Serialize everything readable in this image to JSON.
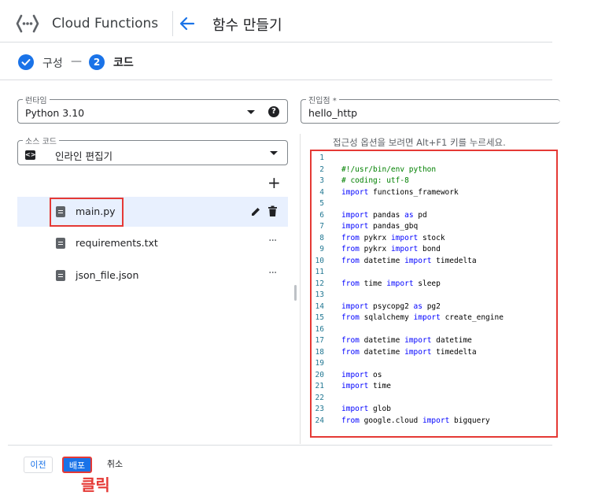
{
  "header": {
    "app_title": "Cloud Functions",
    "page_title": "함수 만들기",
    "icons": [
      "cloud-functions-logo",
      "back-arrow-icon"
    ]
  },
  "stepper": {
    "step1_label": "구성",
    "separator": "—",
    "step2_number": "2",
    "step2_label": "코드"
  },
  "runtime": {
    "label": "런타임",
    "value": "Python 3.10"
  },
  "entry_point": {
    "label": "진입점 *",
    "value": "hello_http"
  },
  "source_code": {
    "label": "소스 코드",
    "value": "인라인 편집기",
    "icon_glyph": "<>"
  },
  "files": {
    "add_glyph": "+",
    "items": [
      {
        "name": "main.py"
      },
      {
        "name": "requirements.txt"
      },
      {
        "name": "json_file.json"
      }
    ],
    "more_glyph": "···"
  },
  "editor": {
    "a11y_hint": "접근성 옵션을 보려면 Alt+F1 키를 누르세요.",
    "lines": [
      {
        "n": "1",
        "text": ""
      },
      {
        "n": "2",
        "text": "#!/usr/bin/env python"
      },
      {
        "n": "3",
        "text": "# coding: utf-8"
      },
      {
        "n": "4",
        "text": "import functions_framework"
      },
      {
        "n": "5",
        "text": ""
      },
      {
        "n": "6",
        "text": "import pandas as pd"
      },
      {
        "n": "7",
        "text": "import pandas_gbq"
      },
      {
        "n": "8",
        "text": "from pykrx import stock"
      },
      {
        "n": "9",
        "text": "from pykrx import bond"
      },
      {
        "n": "10",
        "text": "from datetime import timedelta"
      },
      {
        "n": "11",
        "text": ""
      },
      {
        "n": "12",
        "text": "from time import sleep"
      },
      {
        "n": "13",
        "text": ""
      },
      {
        "n": "14",
        "text": "import psycopg2 as pg2"
      },
      {
        "n": "15",
        "text": "from sqlalchemy import create_engine"
      },
      {
        "n": "16",
        "text": ""
      },
      {
        "n": "17",
        "text": "from datetime import datetime"
      },
      {
        "n": "18",
        "text": "from datetime import timedelta"
      },
      {
        "n": "19",
        "text": ""
      },
      {
        "n": "20",
        "text": "import os"
      },
      {
        "n": "21",
        "text": "import time"
      },
      {
        "n": "22",
        "text": ""
      },
      {
        "n": "23",
        "text": "import glob"
      },
      {
        "n": "24",
        "text": "from google.cloud import bigquery"
      }
    ]
  },
  "actions": {
    "prev": "이전",
    "deploy": "배포",
    "cancel": "취소",
    "click_note": "클릭"
  },
  "colors": {
    "accent": "#1a73e8",
    "annotation_red": "#e53935",
    "keyword": "#0000ff",
    "comment": "#008000",
    "line_number": "#237893"
  }
}
